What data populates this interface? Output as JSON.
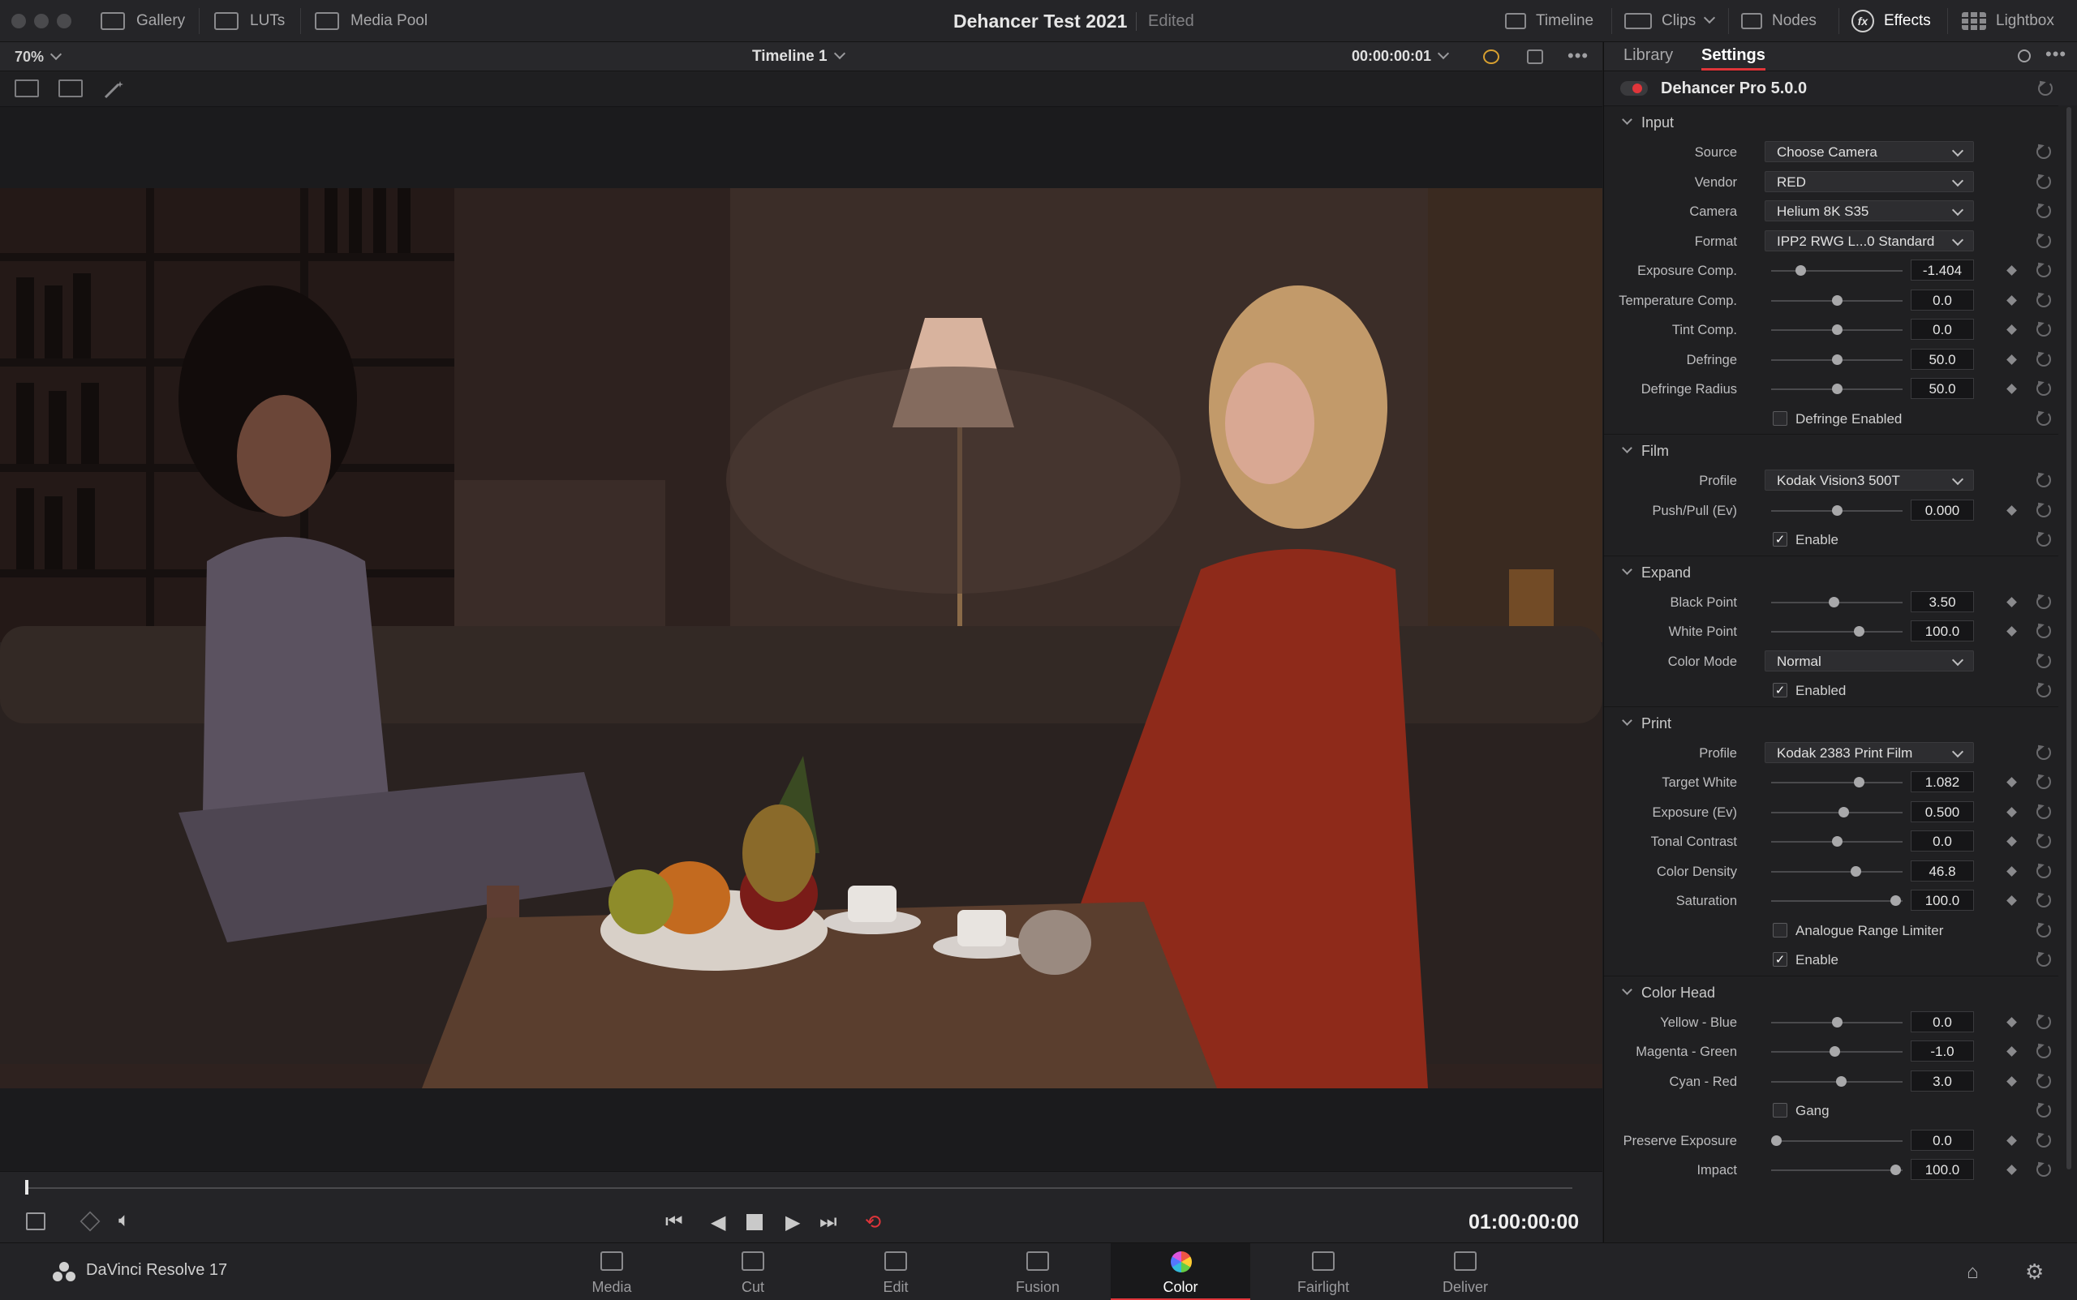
{
  "topbar": {
    "left": [
      {
        "label": "Gallery",
        "icon": "gallery-icon"
      },
      {
        "label": "LUTs",
        "icon": "luts-icon"
      },
      {
        "label": "Media Pool",
        "icon": "media-pool-icon"
      }
    ],
    "project_title": "Dehancer Test 2021",
    "project_status": "Edited",
    "right": [
      {
        "label": "Timeline",
        "icon": "timeline-icon"
      },
      {
        "label": "Clips",
        "icon": "clips-icon"
      },
      {
        "label": "Nodes",
        "icon": "nodes-icon"
      },
      {
        "label": "Effects",
        "icon": "fx-icon"
      },
      {
        "label": "Lightbox",
        "icon": "lightbox-icon"
      }
    ]
  },
  "viewer": {
    "zoom": "70%",
    "timeline_name": "Timeline 1",
    "timecode": "00:00:00:01"
  },
  "transport": {
    "timecode": "01:00:00:00"
  },
  "pagebar": {
    "app_name": "DaVinci Resolve 17",
    "pages": [
      "Media",
      "Cut",
      "Edit",
      "Fusion",
      "Color",
      "Fairlight",
      "Deliver"
    ],
    "active_page": "Color"
  },
  "inspector": {
    "tabs": [
      "Library",
      "Settings"
    ],
    "active_tab": "Settings",
    "plugin_name": "Dehancer Pro 5.0.0",
    "sections": [
      {
        "name": "Input",
        "rows": [
          {
            "type": "dropdown",
            "label": "Source",
            "value": "Choose Camera"
          },
          {
            "type": "dropdown",
            "label": "Vendor",
            "value": "RED"
          },
          {
            "type": "dropdown",
            "label": "Camera",
            "value": "Helium 8K S35"
          },
          {
            "type": "dropdown",
            "label": "Format",
            "value": "IPP2 RWG L...0 Standard"
          },
          {
            "type": "slider",
            "label": "Exposure Comp.",
            "value": "-1.404",
            "pos": 0.2
          },
          {
            "type": "slider",
            "label": "Temperature Comp.",
            "value": "0.0",
            "pos": 0.5
          },
          {
            "type": "slider",
            "label": "Tint Comp.",
            "value": "0.0",
            "pos": 0.5
          },
          {
            "type": "slider",
            "label": "Defringe",
            "value": "50.0",
            "pos": 0.5
          },
          {
            "type": "slider",
            "label": "Defringe Radius",
            "value": "50.0",
            "pos": 0.5
          },
          {
            "type": "checkbox",
            "label": "Defringe Enabled",
            "checked": false
          }
        ]
      },
      {
        "name": "Film",
        "rows": [
          {
            "type": "dropdown",
            "label": "Profile",
            "value": "Kodak Vision3 500T"
          },
          {
            "type": "slider",
            "label": "Push/Pull (Ev)",
            "value": "0.000",
            "pos": 0.5
          },
          {
            "type": "checkbox",
            "label": "Enable",
            "checked": true
          }
        ]
      },
      {
        "name": "Expand",
        "rows": [
          {
            "type": "slider",
            "label": "Black Point",
            "value": "3.50",
            "pos": 0.47
          },
          {
            "type": "slider",
            "label": "White Point",
            "value": "100.0",
            "pos": 0.68
          },
          {
            "type": "dropdown",
            "label": "Color Mode",
            "value": "Normal"
          },
          {
            "type": "checkbox",
            "label": "Enabled",
            "checked": true
          }
        ]
      },
      {
        "name": "Print",
        "rows": [
          {
            "type": "dropdown",
            "label": "Profile",
            "value": "Kodak 2383 Print Film"
          },
          {
            "type": "slider",
            "label": "Target White",
            "value": "1.082",
            "pos": 0.68
          },
          {
            "type": "slider",
            "label": "Exposure (Ev)",
            "value": "0.500",
            "pos": 0.55
          },
          {
            "type": "slider",
            "label": "Tonal Contrast",
            "value": "0.0",
            "pos": 0.5
          },
          {
            "type": "slider",
            "label": "Color Density",
            "value": "46.8",
            "pos": 0.65
          },
          {
            "type": "slider",
            "label": "Saturation",
            "value": "100.0",
            "pos": 0.98
          },
          {
            "type": "checkbox",
            "label": "Analogue Range Limiter",
            "checked": false
          },
          {
            "type": "checkbox",
            "label": "Enable",
            "checked": true
          }
        ]
      },
      {
        "name": "Color Head",
        "rows": [
          {
            "type": "slider",
            "label": "Yellow - Blue",
            "value": "0.0",
            "pos": 0.5
          },
          {
            "type": "slider",
            "label": "Magenta - Green",
            "value": "-1.0",
            "pos": 0.48
          },
          {
            "type": "slider",
            "label": "Cyan - Red",
            "value": "3.0",
            "pos": 0.53
          },
          {
            "type": "checkbox",
            "label": "Gang",
            "checked": false
          },
          {
            "type": "slider",
            "label": "Preserve Exposure",
            "value": "0.0",
            "pos": 0.0
          },
          {
            "type": "slider",
            "label": "Impact",
            "value": "100.0",
            "pos": 0.98
          }
        ]
      }
    ]
  },
  "colors": {
    "accent_red": "#e0353a",
    "panel_bg": "#202022",
    "topbar_bg": "#252528"
  }
}
